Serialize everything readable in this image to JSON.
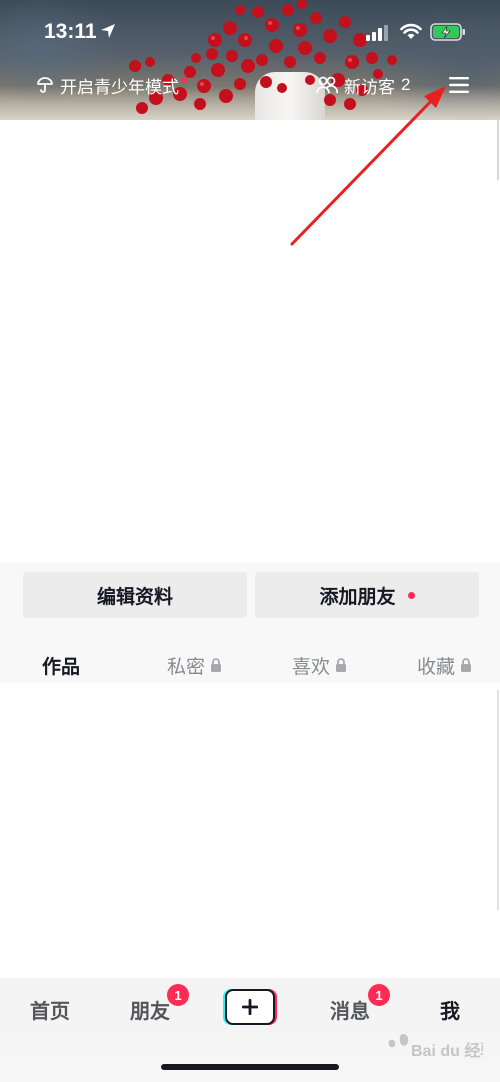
{
  "status_bar": {
    "time": "13:11"
  },
  "header": {
    "teen_mode_label": "开启青少年模式",
    "visitors_label": "新访客",
    "visitors_count": "2"
  },
  "actions": {
    "edit_profile_label": "编辑资料",
    "add_friends_label": "添加朋友"
  },
  "tabs": [
    {
      "label": "作品",
      "active": true,
      "locked": false
    },
    {
      "label": "私密",
      "active": false,
      "locked": true
    },
    {
      "label": "喜欢",
      "active": false,
      "locked": true
    },
    {
      "label": "收藏",
      "active": false,
      "locked": true
    }
  ],
  "bottom_nav": {
    "home_label": "首页",
    "friends_label": "朋友",
    "friends_badge": "1",
    "messages_label": "消息",
    "messages_badge": "1",
    "me_label": "我"
  },
  "watermark": {
    "text": "Bai du 经验"
  },
  "colors": {
    "accent_red": "#fe2c55",
    "annotation_red": "#e8201f",
    "text_primary": "#161823",
    "text_secondary": "#8a8b91",
    "button_bg": "#ececec"
  },
  "icons": [
    "location-arrow-icon",
    "signal-icon",
    "wifi-icon",
    "battery-charging-icon",
    "umbrella-icon",
    "visitors-icon",
    "menu-icon",
    "lock-icon",
    "plus-icon"
  ]
}
